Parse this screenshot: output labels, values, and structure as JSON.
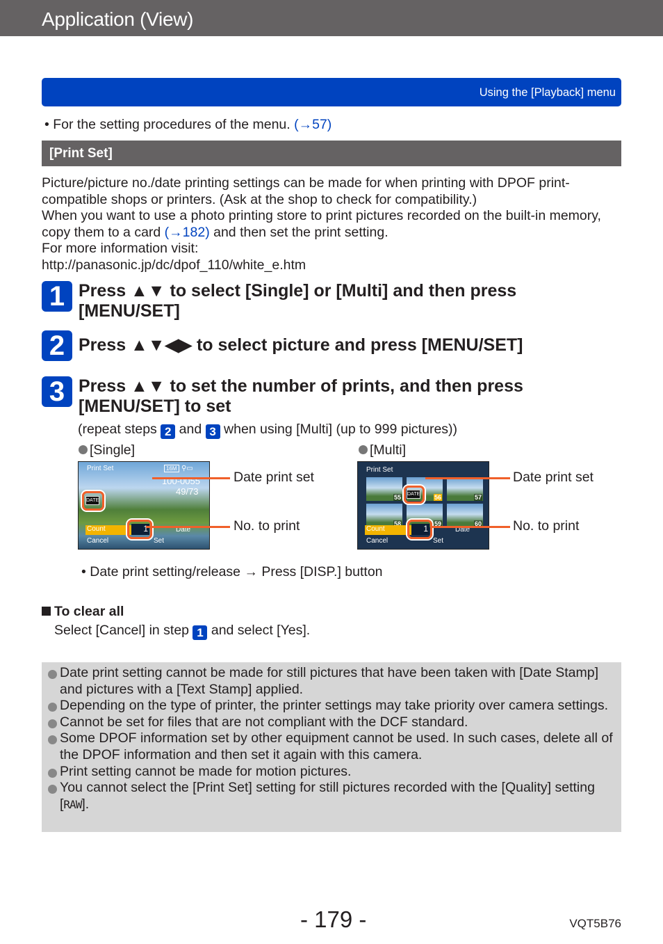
{
  "header": {
    "title": "Application (View)"
  },
  "breadcrumb": {
    "label": "Using the [Playback] menu"
  },
  "setting_note": {
    "text": "• For the setting procedures of the menu. ",
    "link": "(→57)"
  },
  "section": {
    "title": "[Print Set]",
    "intro": {
      "line1": "Picture/picture no./date printing settings can be made for when printing with DPOF print-compatible shops or printers. (Ask at the shop to check for compatibility.)",
      "line2_pre": "When you want to use a photo printing store to print pictures recorded on the built-in memory, copy them to a card ",
      "line2_link": "(→182)",
      "line2_post": " and then set the print setting.",
      "line3": "For more information visit:",
      "url": "http://panasonic.jp/dc/dpof_110/white_e.htm"
    }
  },
  "steps": [
    {
      "number": "1",
      "text": "Press ▲▼ to select [Single] or [Multi] and then press [MENU/SET]"
    },
    {
      "number": "2",
      "text": "Press ▲▼◀▶ to select picture and press [MENU/SET]"
    },
    {
      "number": "3",
      "text": "Press ▲▼ to set the number of prints, and then press [MENU/SET] to set"
    }
  ],
  "repeat_note": {
    "pre": "(repeat steps ",
    "step_a": "2",
    "mid": " and ",
    "step_b": "3",
    "post": " when using [Multi] (up to 999 pictures))"
  },
  "modes": {
    "single": {
      "label": "[Single]",
      "screen": {
        "title": "Print Set",
        "size_badge": "16M",
        "file_no": "100-0055",
        "frame": "49/73",
        "date_badge": "DATE",
        "count_label": "Count",
        "count_value": "1",
        "date_label": "Date",
        "cancel_label": "Cancel",
        "set_label": "Set"
      },
      "callouts": {
        "date": "Date print set",
        "count": "No. to print"
      }
    },
    "multi": {
      "label": "[Multi]",
      "screen": {
        "title": "Print Set",
        "thumb_numbers": [
          "55",
          "56",
          "57",
          "58",
          "59",
          "60"
        ],
        "selected": "56",
        "date_badge": "DATE",
        "count_label": "Count",
        "count_value": "1",
        "date_label": "Date",
        "cancel_label": "Cancel",
        "set_label": "Set"
      },
      "callouts": {
        "date": "Date print set",
        "count": "No. to print"
      }
    }
  },
  "disp_note": "• Date print setting/release → Press [DISP.] button",
  "clear_all": {
    "heading": "To clear all",
    "pre": "Select [Cancel] in step ",
    "step": "1",
    "post": " and select [Yes]."
  },
  "notes": [
    "Date print setting cannot be made for still pictures that have been taken with [Date Stamp] and pictures with a [Text Stamp] applied.",
    "Depending on the type of printer, the printer settings may take priority over camera settings.",
    "Cannot be set for files that are not compliant with the DCF standard.",
    "Some DPOF information set by other equipment cannot be used. In such cases, delete all of the DPOF information and then set it again with this camera.",
    "Print setting cannot be made for motion pictures."
  ],
  "last_note": {
    "pre": "You cannot select the [Print Set] setting for still pictures recorded with the [Quality] setting [",
    "raw": "RAW",
    "post": "]."
  },
  "footer": {
    "page": "- 179 -",
    "code": "VQT5B76"
  }
}
